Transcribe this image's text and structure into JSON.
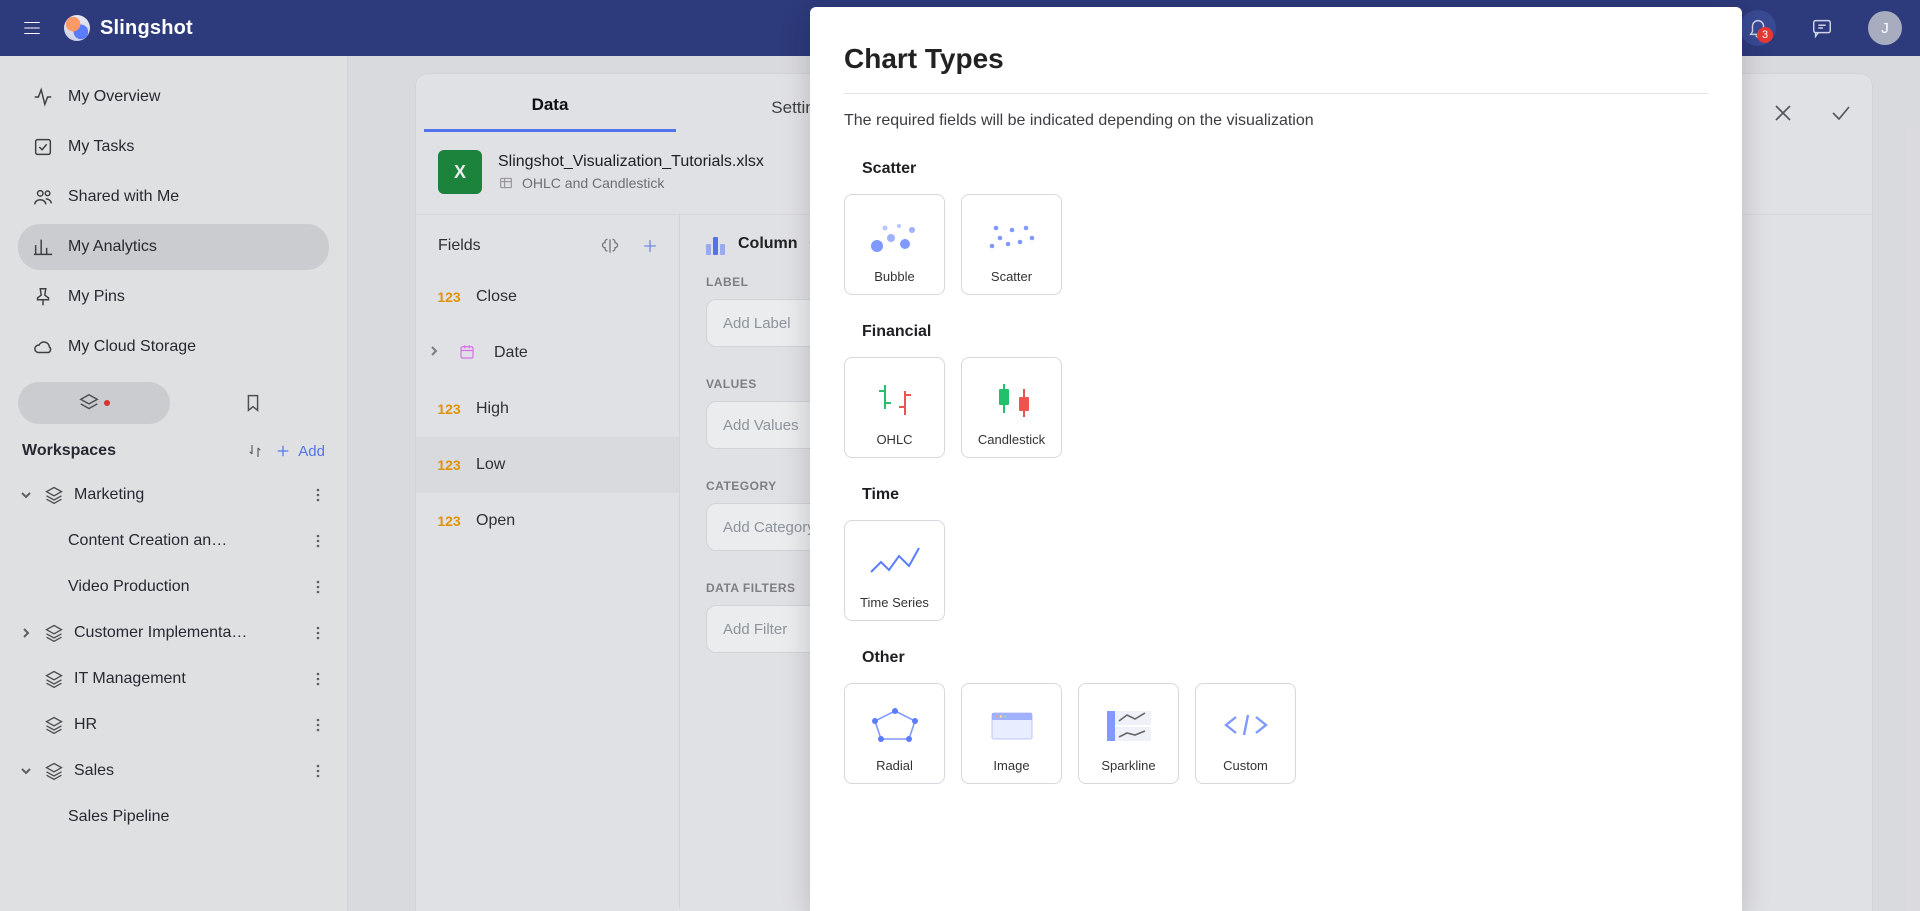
{
  "brand": {
    "name": "Slingshot"
  },
  "notifications": {
    "count": "3"
  },
  "avatar": {
    "initial": "J"
  },
  "sidebar": {
    "items": [
      {
        "label": "My Overview"
      },
      {
        "label": "My Tasks"
      },
      {
        "label": "Shared with Me"
      },
      {
        "label": "My Analytics"
      },
      {
        "label": "My Pins"
      },
      {
        "label": "My Cloud Storage"
      }
    ],
    "workspaces_title": "Workspaces",
    "add_label": "Add",
    "tree": [
      {
        "label": "Marketing",
        "children": [
          {
            "label": "Content Creation an…"
          },
          {
            "label": "Video Production"
          }
        ]
      },
      {
        "label": "Customer Implementa…"
      },
      {
        "label": "IT Management"
      },
      {
        "label": "HR"
      },
      {
        "label": "Sales",
        "children": [
          {
            "label": "Sales Pipeline"
          }
        ]
      }
    ]
  },
  "tabs": [
    {
      "label": "Data"
    },
    {
      "label": "Settings"
    }
  ],
  "source": {
    "filename": "Slingshot_Visualization_Tutorials.xlsx",
    "sheet": "OHLC and Candlestick",
    "xls_glyph": "X"
  },
  "fields": {
    "title": "Fields",
    "num_type": "123",
    "items": [
      {
        "label": "Close",
        "type": "num"
      },
      {
        "label": "Date",
        "type": "date"
      },
      {
        "label": "High",
        "type": "num"
      },
      {
        "label": "Low",
        "type": "num"
      },
      {
        "label": "Open",
        "type": "num"
      }
    ]
  },
  "design": {
    "chart_label": "Column",
    "sections": {
      "label": {
        "title": "LABEL",
        "placeholder": "Add Label"
      },
      "values": {
        "title": "VALUES",
        "placeholder": "Add Values"
      },
      "category": {
        "title": "CATEGORY",
        "placeholder": "Add Category"
      },
      "filters": {
        "title": "DATA FILTERS",
        "placeholder": "Add Filter"
      }
    }
  },
  "modal": {
    "title": "Chart Types",
    "hint": "The required fields will be indicated depending on the visualization",
    "groups": [
      {
        "title": "Scatter",
        "cards": [
          {
            "label": "Bubble"
          },
          {
            "label": "Scatter"
          }
        ]
      },
      {
        "title": "Financial",
        "cards": [
          {
            "label": "OHLC"
          },
          {
            "label": "Candlestick"
          }
        ]
      },
      {
        "title": "Time",
        "cards": [
          {
            "label": "Time Series"
          }
        ]
      },
      {
        "title": "Other",
        "cards": [
          {
            "label": "Radial"
          },
          {
            "label": "Image"
          },
          {
            "label": "Sparkline"
          },
          {
            "label": "Custom"
          }
        ]
      }
    ]
  }
}
